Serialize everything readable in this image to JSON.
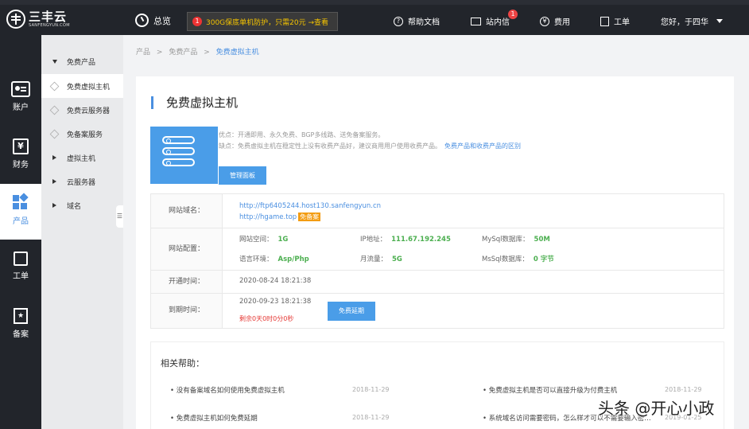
{
  "brand": {
    "name": "三丰云",
    "sub": "SANFENGYUN.COM"
  },
  "topbar": {
    "overview": "总览",
    "promo_badge": "1",
    "promo_text": "300G保底单机防护，只需20元 →查看",
    "help_docs": "帮助文档",
    "messages": "站内信",
    "messages_badge": "1",
    "fees": "费用",
    "tickets": "工单",
    "greeting": "您好，于四华"
  },
  "rail": [
    {
      "label": "账户",
      "icon": "account-icon"
    },
    {
      "label": "财务",
      "icon": "finance-icon",
      "glyph": "¥"
    },
    {
      "label": "产品",
      "icon": "product-icon",
      "active": true
    },
    {
      "label": "工单",
      "icon": "ticket-icon"
    },
    {
      "label": "备案",
      "icon": "record-icon",
      "glyph": "★"
    }
  ],
  "submenu": {
    "free_products": "免费产品",
    "free_vhost": "免费虚拟主机",
    "free_cloud": "免费云服务器",
    "free_nofiling": "免备案服务",
    "vhost": "虚拟主机",
    "cloud": "云服务器",
    "domain": "域名",
    "collapse": "☰"
  },
  "breadcrumb": {
    "root": "产品",
    "mid": "免费产品",
    "current": "免费虚拟主机",
    "sep": ">"
  },
  "page": {
    "title": "免费虚拟主机",
    "pros": "优点：开通即用、永久免费、BGP多线路、送免备案服务。",
    "cons": "缺点：免费虚拟主机在稳定性上没有收费产品好，建议商用用户使用收费产品。",
    "compare_link": "免费产品和收费产品的区别",
    "manage_button": "管理面板"
  },
  "info": {
    "domain_label": "网站域名：",
    "domain1": "http://ftp6405244.host130.sanfengyun.cn",
    "domain2": "http://hgame.top",
    "domain2_tag": "免备案",
    "config_label": "网站配置：",
    "space_label": "网站空间：",
    "space_value": "1G",
    "ip_label": "IP地址：",
    "ip_value": "111.67.192.245",
    "mysql_label": "MySql数据库：",
    "mysql_value": "50M",
    "lang_label": "语言环境：",
    "lang_value": "Asp/Php",
    "traffic_label": "月流量：",
    "traffic_value": "5G",
    "mssql_label": "MsSql数据库：",
    "mssql_value": "0 字节",
    "open_label": "开通时间：",
    "open_value": "2020-08-24 18:21:38",
    "expire_label": "到期时间：",
    "expire_value": "2020-09-23 18:21:38",
    "remaining": "剩余0天0时0分0秒",
    "renew_button": "免费延期"
  },
  "help": {
    "title": "相关帮助：",
    "items": [
      {
        "text": "• 没有备案域名如何使用免费虚拟主机",
        "date": "2018-11-29"
      },
      {
        "text": "• 免费虚拟主机是否可以直接升级为付费主机",
        "date": "2018-11-29"
      },
      {
        "text": "• 免费虚拟主机如何免费延期",
        "date": "2018-11-29"
      },
      {
        "text": "• 系统域名访问需要密码，怎么样才可以不需要输入密…",
        "date": "2019-01-25"
      }
    ]
  },
  "watermark": "头条 @开心小政"
}
